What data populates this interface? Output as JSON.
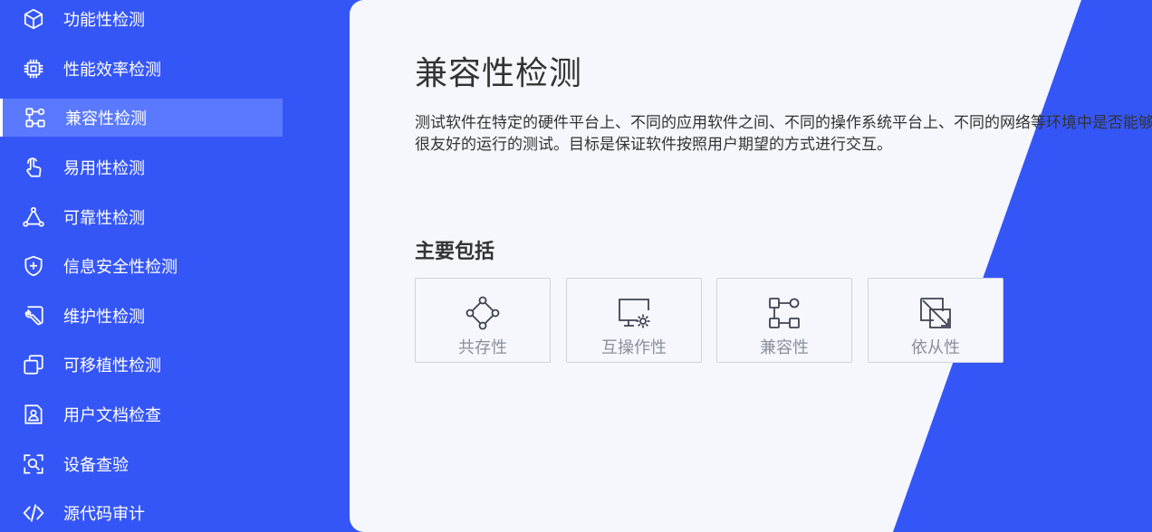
{
  "sidebar": {
    "items": [
      {
        "label": "功能性检测",
        "icon": "cube-icon"
      },
      {
        "label": "性能效率检测",
        "icon": "chip-icon"
      },
      {
        "label": "兼容性检测",
        "icon": "nodes-icon",
        "active": true
      },
      {
        "label": "易用性检测",
        "icon": "touch-icon"
      },
      {
        "label": "可靠性检测",
        "icon": "triangle-nodes-icon"
      },
      {
        "label": "信息安全性检测",
        "icon": "shield-plus-icon"
      },
      {
        "label": "维护性检测",
        "icon": "wrench-icon"
      },
      {
        "label": "可移植性检测",
        "icon": "copy-icon"
      },
      {
        "label": "用户文档检查",
        "icon": "user-document-icon"
      },
      {
        "label": "设备查验",
        "icon": "scan-search-icon"
      },
      {
        "label": "源代码审计",
        "icon": "code-icon"
      }
    ]
  },
  "main": {
    "title": "兼容性检测",
    "description": "测试软件在特定的硬件平台上、不同的应用软件之间、不同的操作系统平台上、不同的网络等环境中是否能够很友好的运行的测试。目标是保证软件按照用户期望的方式进行交互。",
    "section_title": "主要包括",
    "cards": [
      {
        "label": "共存性",
        "icon": "coexistence-icon"
      },
      {
        "label": "互操作性",
        "icon": "monitor-gear-icon"
      },
      {
        "label": "兼容性",
        "icon": "nodes-icon"
      },
      {
        "label": "依从性",
        "icon": "compliance-icon"
      }
    ]
  },
  "colors": {
    "sidebar_bg": "#3556f7",
    "sidebar_active_bg": "#5a79ff",
    "panel_bg": "#f5f7fd",
    "card_border": "#cfd3dc",
    "card_text": "#8a8f99"
  }
}
